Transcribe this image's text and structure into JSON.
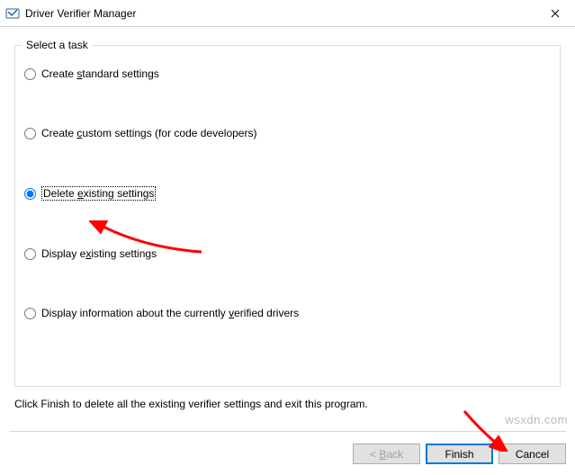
{
  "window": {
    "title": "Driver Verifier Manager"
  },
  "groupbox": {
    "title": "Select a task",
    "options": [
      {
        "label": "Create standard settings",
        "accel": "s",
        "selected": false
      },
      {
        "label": "Create custom settings (for code developers)",
        "accel": "c",
        "selected": false
      },
      {
        "label": "Delete existing settings",
        "accel": "e",
        "selected": true
      },
      {
        "label": "Display existing settings",
        "accel": "x",
        "selected": false
      },
      {
        "label": "Display information about the currently verified drivers",
        "accel": "v",
        "selected": false
      }
    ]
  },
  "instruction": "Click Finish to delete all the existing verifier settings and exit this program.",
  "buttons": {
    "back": "< Back",
    "finish": "Finish",
    "cancel": "Cancel"
  },
  "watermark": "wsxdn.com",
  "chart_data": null
}
